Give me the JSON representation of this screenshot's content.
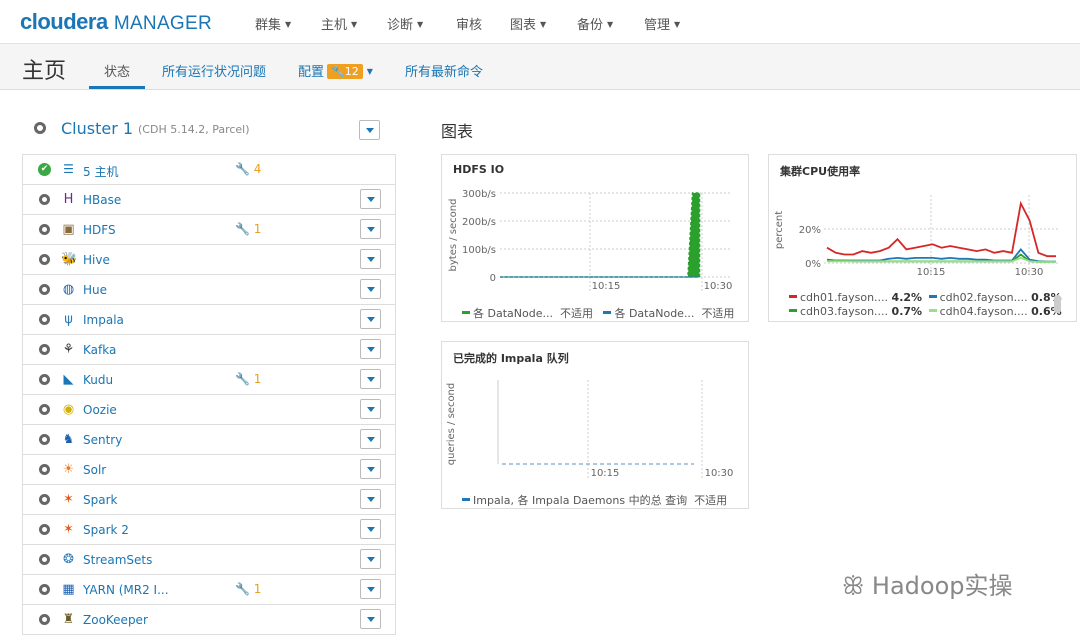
{
  "brand": {
    "logo_bold": "cloudera",
    "logo_rest": "MANAGER"
  },
  "topnav": {
    "items": [
      "群集",
      "主机",
      "诊断",
      "审核",
      "图表",
      "备份",
      "管理"
    ]
  },
  "subbar": {
    "title": "主页",
    "tabs": [
      "状态",
      "所有运行状况问题",
      "配置",
      "所有最新命令"
    ],
    "config_badge": "12"
  },
  "cluster": {
    "name": "Cluster 1",
    "detail": "(CDH 5.14.2, Parcel)"
  },
  "hosts_row": {
    "label": "5 主机",
    "warnings": "4"
  },
  "services": [
    {
      "name": "HBase",
      "icon": "hbase-icon",
      "warnings": ""
    },
    {
      "name": "HDFS",
      "icon": "hdfs-icon",
      "warnings": "1"
    },
    {
      "name": "Hive",
      "icon": "hive-icon",
      "warnings": ""
    },
    {
      "name": "Hue",
      "icon": "hue-icon",
      "warnings": ""
    },
    {
      "name": "Impala",
      "icon": "impala-icon",
      "warnings": ""
    },
    {
      "name": "Kafka",
      "icon": "kafka-icon",
      "warnings": ""
    },
    {
      "name": "Kudu",
      "icon": "kudu-icon",
      "warnings": "1"
    },
    {
      "name": "Oozie",
      "icon": "oozie-icon",
      "warnings": ""
    },
    {
      "name": "Sentry",
      "icon": "sentry-icon",
      "warnings": ""
    },
    {
      "name": "Solr",
      "icon": "solr-icon",
      "warnings": ""
    },
    {
      "name": "Spark",
      "icon": "spark-icon",
      "warnings": ""
    },
    {
      "name": "Spark 2",
      "icon": "spark-icon",
      "warnings": ""
    },
    {
      "name": "StreamSets",
      "icon": "streamsets-icon",
      "warnings": ""
    },
    {
      "name": "YARN (MR2 I...",
      "icon": "yarn-icon",
      "warnings": "1"
    },
    {
      "name": "ZooKeeper",
      "icon": "zookeeper-icon",
      "warnings": ""
    }
  ],
  "charts_heading": "图表",
  "charts": {
    "hdfs": {
      "title": "HDFS IO",
      "ylabel": "bytes / second",
      "yticks": [
        "300b/s",
        "200b/s",
        "100b/s",
        "0"
      ],
      "xticks": [
        "10:15",
        "10:30"
      ],
      "legend": [
        {
          "name": "各 DataNode...",
          "value": "不适用",
          "color": "#2ca02c"
        },
        {
          "name": "各 DataNode...",
          "value": "不适用",
          "color": "#1f77b4"
        }
      ]
    },
    "cpu": {
      "title": "集群CPU使用率",
      "ylabel": "percent",
      "yticks": [
        "20%",
        "0%"
      ],
      "xticks": [
        "10:15",
        "10:30"
      ],
      "legend": [
        {
          "name": "cdh01.fayson....",
          "value": "4.2%",
          "color": "#d62728"
        },
        {
          "name": "cdh02.fayson....",
          "value": "0.8%",
          "color": "#1f77b4"
        },
        {
          "name": "cdh03.fayson....",
          "value": "0.7%",
          "color": "#2ca02c"
        },
        {
          "name": "cdh04.fayson....",
          "value": "0.6%",
          "color": "#98df8a"
        }
      ]
    },
    "impala": {
      "title": "已完成的 Impala 队列",
      "ylabel": "queries / second",
      "xticks": [
        "10:15",
        "10:30"
      ],
      "legend": [
        {
          "name": "Impala, 各 Impala Daemons 中的总 查询",
          "value": "不适用",
          "color": "#1f77b4"
        }
      ]
    }
  },
  "chart_data": [
    {
      "type": "area",
      "title": "HDFS IO",
      "ylabel": "bytes / second",
      "ylim": [
        0,
        300
      ],
      "series": [
        {
          "name": "各 DataNode...",
          "x": [
            "10:05",
            "10:15",
            "10:26",
            "10:27",
            "10:28"
          ],
          "values": [
            0,
            0,
            0,
            300,
            300
          ]
        },
        {
          "name": "各 DataNode...",
          "x": [
            "10:05",
            "10:15",
            "10:28"
          ],
          "values": [
            0,
            0,
            0
          ]
        }
      ]
    },
    {
      "type": "line",
      "title": "集群CPU使用率",
      "ylabel": "percent",
      "ylim": [
        0,
        40
      ],
      "series": [
        {
          "name": "cdh01.fayson....",
          "values": [
            9,
            6,
            5,
            5,
            7,
            6,
            7,
            9,
            14,
            8,
            9,
            10,
            11,
            9,
            10,
            9,
            8,
            7,
            8,
            6,
            7,
            6,
            35,
            25,
            6,
            4,
            4
          ]
        },
        {
          "name": "cdh02.fayson....",
          "values": [
            2,
            1.5,
            1.5,
            1.5,
            1.5,
            1.5,
            1.5,
            2.5,
            3,
            2.5,
            3,
            3,
            3,
            2.5,
            3,
            2.5,
            2.5,
            2,
            2,
            1.5,
            1.5,
            1.5,
            8,
            2,
            1,
            0.8,
            0.8
          ]
        },
        {
          "name": "cdh03.fayson....",
          "values": [
            1.5,
            1.5,
            1.5,
            1,
            1,
            1,
            1,
            1,
            1,
            1,
            1,
            1,
            1,
            1,
            1,
            1,
            1,
            1,
            1,
            1,
            1,
            1,
            5,
            1,
            0.7,
            0.7,
            0.7
          ]
        },
        {
          "name": "cdh04.fayson....",
          "values": [
            1,
            1,
            1,
            1,
            1,
            1,
            1,
            1,
            1,
            1,
            1,
            1,
            1,
            1,
            1,
            1,
            1,
            1,
            1,
            1,
            1,
            1,
            3,
            1,
            0.6,
            0.6,
            0.6
          ]
        }
      ]
    },
    {
      "type": "line",
      "title": "已完成的 Impala 队列",
      "ylabel": "queries / second",
      "series": [
        {
          "name": "Impala, 各 Impala Daemons 中的总 查询",
          "values": [
            0,
            0,
            0,
            0,
            0,
            0,
            0,
            0,
            0,
            0
          ]
        }
      ]
    }
  ],
  "watermark": "Hadoop实操"
}
